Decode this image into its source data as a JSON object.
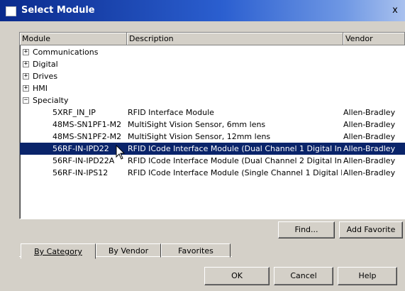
{
  "window": {
    "title": "Select Module",
    "close_label": "x"
  },
  "columns": {
    "module": "Module",
    "description": "Description",
    "vendor": "Vendor"
  },
  "categories": [
    {
      "label": "Communications",
      "expander": "+"
    },
    {
      "label": "Digital",
      "expander": "+"
    },
    {
      "label": "Drives",
      "expander": "+"
    },
    {
      "label": "HMI",
      "expander": "+"
    },
    {
      "label": "Specialty",
      "expander": "−"
    }
  ],
  "modules": [
    {
      "module": "5XRF_IN_IP",
      "description": "RFID Interface Module",
      "vendor": "Allen-Bradley",
      "selected": false
    },
    {
      "module": "48MS-SN1PF1-M2",
      "description": "MultiSight Vision Sensor, 6mm lens",
      "vendor": "Allen-Bradley",
      "selected": false
    },
    {
      "module": "48MS-SN1PF2-M2",
      "description": "MultiSight Vision Sensor, 12mm lens",
      "vendor": "Allen-Bradley",
      "selected": false
    },
    {
      "module": "56RF-IN-IPD22",
      "description": "RFID ICode Interface Module (Dual Channel 1 Digital In / ...",
      "vendor": "Allen-Bradley",
      "selected": true
    },
    {
      "module": "56RF-IN-IPD22A",
      "description": "RFID ICode Interface Module (Dual Channel 2 Digital Inpu...",
      "vendor": "Allen-Bradley",
      "selected": false
    },
    {
      "module": "56RF-IN-IPS12",
      "description": "RFID ICode Interface Module (Single Channel 1 Digital In ...",
      "vendor": "Allen-Bradley",
      "selected": false
    }
  ],
  "buttons": {
    "find": "Find...",
    "add_favorite": "Add Favorite",
    "ok": "OK",
    "cancel": "Cancel",
    "help": "Help"
  },
  "tabs": [
    {
      "label": "By Category",
      "active": true
    },
    {
      "label": "By Vendor",
      "active": false
    },
    {
      "label": "Favorites",
      "active": false
    }
  ],
  "colors": {
    "selection": "#0a246a",
    "titlebar_start": "#0a2a8c",
    "face": "#d4d0c8"
  },
  "icons": [
    "title-app-icon",
    "close-icon",
    "plus-expander-icon",
    "minus-expander-icon",
    "arrow-cursor-icon"
  ]
}
